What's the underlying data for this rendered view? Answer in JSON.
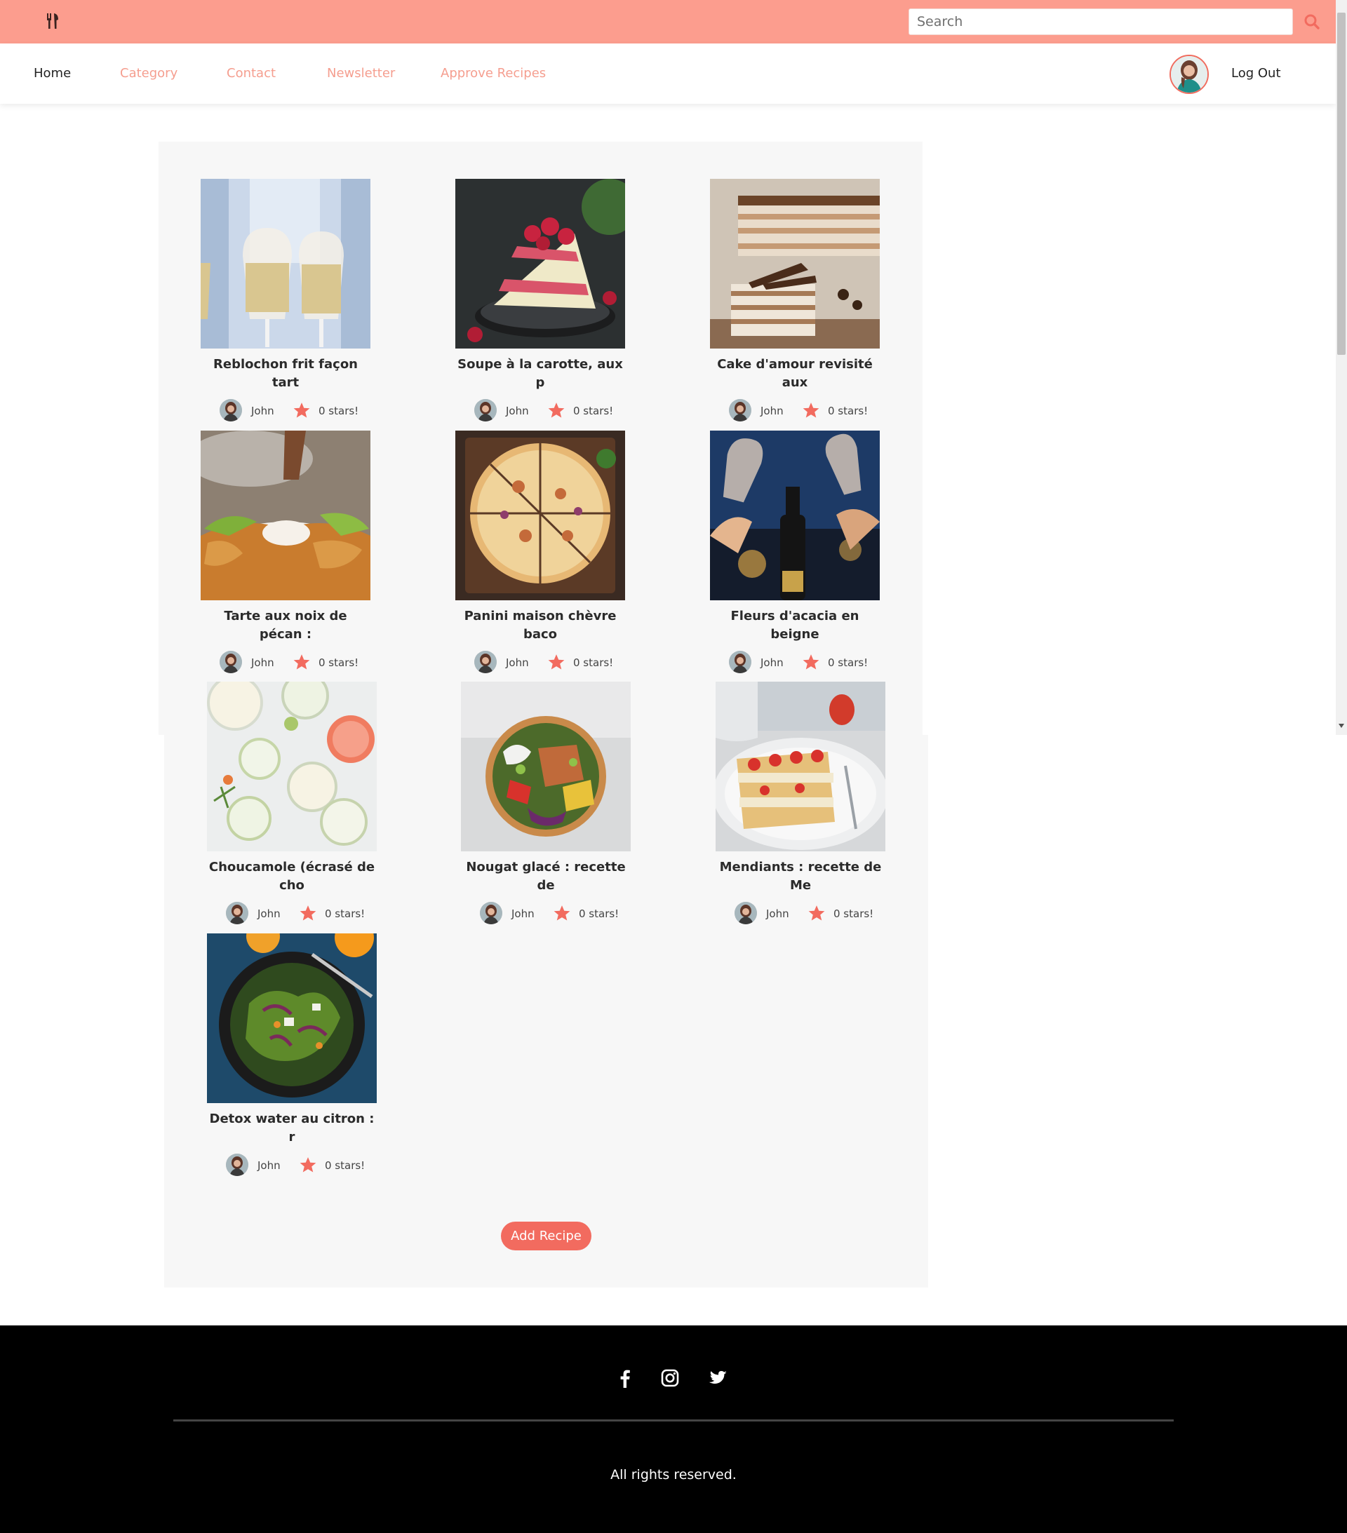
{
  "header": {
    "logo_icon": "fork-knife-icon",
    "search": {
      "placeholder": "Search",
      "value": ""
    },
    "search_icon": "search-icon",
    "accent": "#fc9d8e"
  },
  "nav": {
    "items": [
      {
        "label": "Home",
        "active": true
      },
      {
        "label": "Category",
        "active": false
      },
      {
        "label": "Contact",
        "active": false
      },
      {
        "label": "Newsletter",
        "active": false
      },
      {
        "label": "Approve Recipes",
        "active": false
      }
    ],
    "logout_label": "Log Out",
    "link_color": "#f59e8f"
  },
  "recipes": [
    {
      "title": "Reblochon frit façon tart",
      "author": "John",
      "stars_text": "0 stars!",
      "image": "champagne glasses"
    },
    {
      "title": "Soupe à la carotte, aux p",
      "author": "John",
      "stars_text": "0 stars!",
      "image": "raspberry cake slice"
    },
    {
      "title": "Cake d'amour revisité aux",
      "author": "John",
      "stars_text": "0 stars!",
      "image": "layered tiramisu cake"
    },
    {
      "title": "Tarte aux noix de pécan :",
      "author": "John",
      "stars_text": "0 stars!",
      "image": "fried chicken with dip"
    },
    {
      "title": "Panini maison chèvre baco",
      "author": "John",
      "stars_text": "0 stars!",
      "image": "pizza on board"
    },
    {
      "title": "Fleurs d'acacia en beigne",
      "author": "John",
      "stars_text": "0 stars!",
      "image": "champagne toast"
    },
    {
      "title": "Choucamole (écrasé de cho",
      "author": "John",
      "stars_text": "0 stars!",
      "image": "citrus drinks"
    },
    {
      "title": "Nougat glacé : recette de",
      "author": "John",
      "stars_text": "0 stars!",
      "image": "salad bowl"
    },
    {
      "title": "Mendiants : recette de Me",
      "author": "John",
      "stars_text": "0 stars!",
      "image": "strawberry mille-feuille"
    },
    {
      "title": "Detox water au citron : r",
      "author": "John",
      "stars_text": "0 stars!",
      "image": "green salad plate"
    }
  ],
  "add_recipe_label": "Add Recipe",
  "footer": {
    "social_icons": [
      "facebook-icon",
      "instagram-icon",
      "twitter-icon"
    ],
    "copyright": "All rights reserved."
  },
  "colors": {
    "star": "#f26b5f",
    "button": "#f26b5f",
    "panel": "#f7f7f7"
  }
}
